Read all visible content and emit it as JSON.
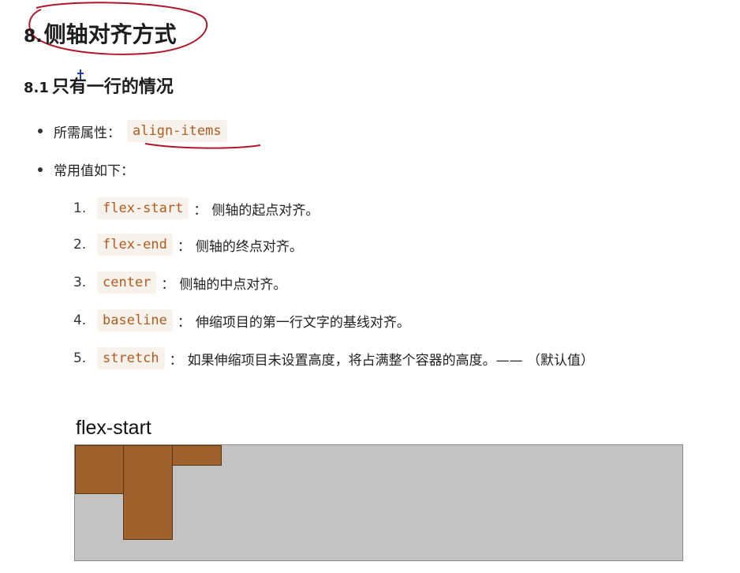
{
  "heading1": {
    "number": "8.",
    "text": "侧轴对齐方式"
  },
  "heading2": {
    "number": "8.1",
    "text": "只有一行的情况"
  },
  "bullets": {
    "prop_label": "所需属性：",
    "prop_code": "align-items",
    "values_label": "常用值如下："
  },
  "values": [
    {
      "n": "1.",
      "code": "flex-start",
      "sep": "：",
      "desc": "侧轴的起点对齐。"
    },
    {
      "n": "2.",
      "code": "flex-end",
      "sep": "：",
      "desc": "侧轴的终点对齐。"
    },
    {
      "n": "3.",
      "code": "center",
      "sep": "：",
      "desc": "侧轴的中点对齐。"
    },
    {
      "n": "4.",
      "code": "baseline",
      "sep": "：",
      "desc": "伸缩项目的第一行文字的基线对齐。"
    },
    {
      "n": "5.",
      "code": "stretch",
      "sep": "：",
      "desc": "如果伸缩项目未设置高度，将占满整个容器的高度。—— （默认值）"
    }
  ],
  "diagram": {
    "title": "flex-start",
    "colors": {
      "container": "#c3c3c3",
      "item": "#a0622c",
      "annotation": "#b0182a"
    }
  }
}
